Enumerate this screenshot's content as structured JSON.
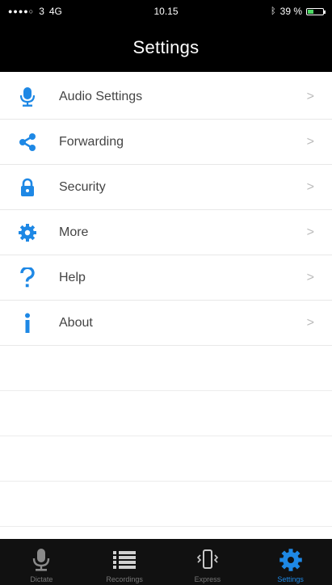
{
  "status_bar": {
    "carrier": "3",
    "network": "4G",
    "time": "10.15",
    "battery_pct": "39 %",
    "battery_level": 0.39
  },
  "header": {
    "title": "Settings"
  },
  "settings": {
    "items": [
      {
        "label": "Audio Settings",
        "icon": "microphone-icon"
      },
      {
        "label": "Forwarding",
        "icon": "share-icon"
      },
      {
        "label": "Security",
        "icon": "lock-icon"
      },
      {
        "label": "More",
        "icon": "gear-icon"
      },
      {
        "label": "Help",
        "icon": "question-icon"
      },
      {
        "label": "About",
        "icon": "info-icon"
      }
    ],
    "chevron": ">"
  },
  "tabs": [
    {
      "label": "Dictate",
      "icon": "microphone-icon",
      "active": false
    },
    {
      "label": "Recordings",
      "icon": "list-icon",
      "active": false
    },
    {
      "label": "Express",
      "icon": "phone-vibrate-icon",
      "active": false
    },
    {
      "label": "Settings",
      "icon": "gear-icon",
      "active": true
    }
  ],
  "colors": {
    "accent": "#1e88e5",
    "bar_background": "#000000",
    "tab_inactive": "#777777"
  }
}
